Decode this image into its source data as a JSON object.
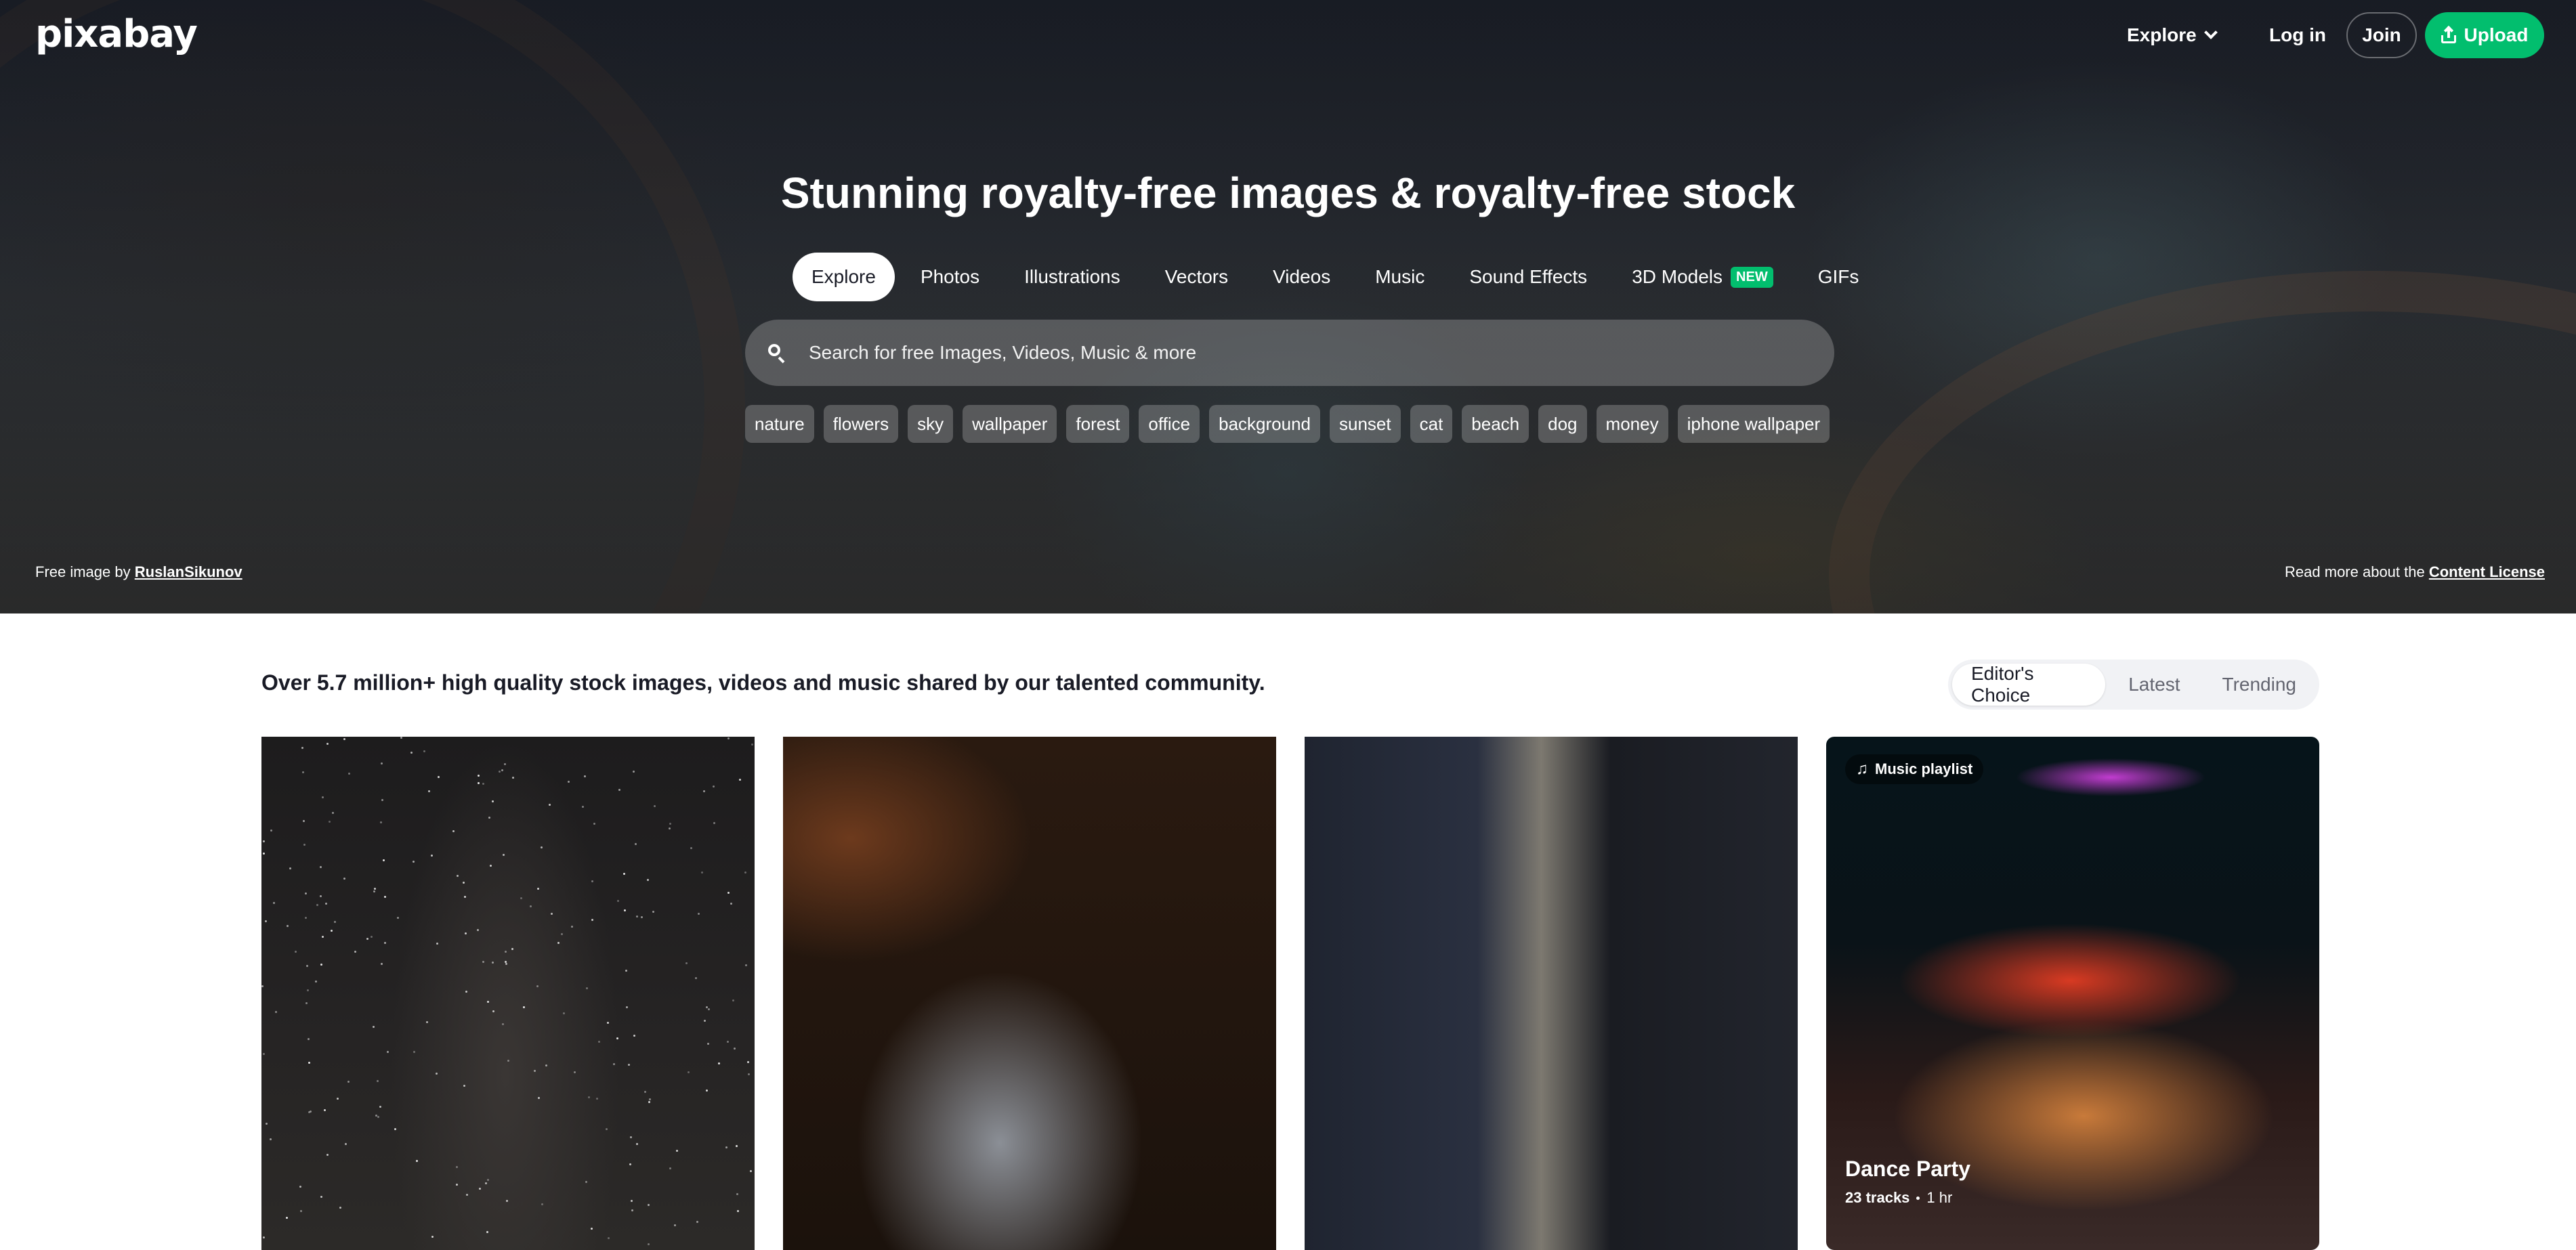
{
  "brand": {
    "logo": "pixabay"
  },
  "nav": {
    "explore": "Explore",
    "login": "Log in",
    "join": "Join",
    "upload": "Upload"
  },
  "hero": {
    "title": "Stunning royalty-free images & royalty-free stock",
    "tabs": [
      {
        "label": "Explore",
        "active": true
      },
      {
        "label": "Photos"
      },
      {
        "label": "Illustrations"
      },
      {
        "label": "Vectors"
      },
      {
        "label": "Videos"
      },
      {
        "label": "Music"
      },
      {
        "label": "Sound Effects"
      },
      {
        "label": "3D Models",
        "badge": "NEW"
      },
      {
        "label": "GIFs"
      }
    ],
    "search_placeholder": "Search for free Images, Videos, Music & more",
    "tags": [
      "nature",
      "flowers",
      "sky",
      "wallpaper",
      "forest",
      "office",
      "background",
      "sunset",
      "cat",
      "beach",
      "dog",
      "money",
      "iphone wallpaper"
    ],
    "credit_prefix": "Free image by",
    "credit_author": "RuslanSikunov",
    "license_prefix": "Read more about the",
    "license_link": "Content License"
  },
  "content": {
    "intro": "Over 5.7 million+ high quality stock images, videos and music shared by our talented community.",
    "sort_options": [
      "Editor's Choice",
      "Latest",
      "Trending"
    ],
    "sort_active": "Editor's Choice",
    "playlist": {
      "badge": "Music playlist",
      "title": "Dance Party",
      "tracks": "23 tracks",
      "duration": "1 hr"
    }
  },
  "colors": {
    "accent": "#02be6e",
    "text": "#191b26"
  }
}
